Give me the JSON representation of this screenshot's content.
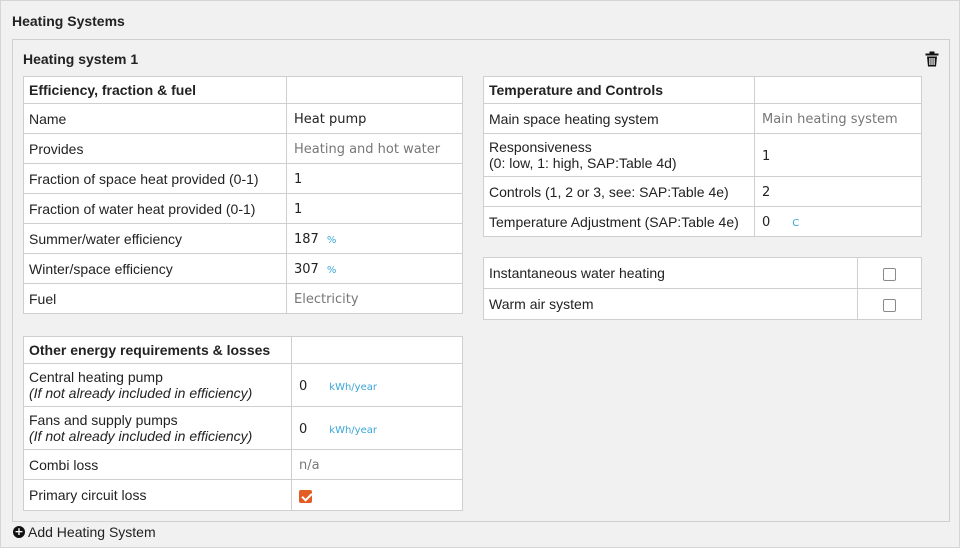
{
  "section_title": "Heating Systems",
  "system": {
    "title": "Heating system 1",
    "delete_icon": "trash-icon"
  },
  "efficiency": {
    "header": "Efficiency, fraction & fuel",
    "rows": [
      {
        "label": "Name",
        "value": "Heat pump"
      },
      {
        "label": "Provides",
        "value": "Heating and hot water"
      },
      {
        "label": "Fraction of space heat provided (0-1)",
        "value": "1"
      },
      {
        "label": "Fraction of water heat provided (0-1)",
        "value": "1"
      },
      {
        "label": "Summer/water efficiency",
        "value": "187",
        "unit": "%"
      },
      {
        "label": "Winter/space efficiency",
        "value": "307",
        "unit": "%"
      },
      {
        "label": "Fuel",
        "value": "Electricity"
      }
    ]
  },
  "temperature": {
    "header": "Temperature and Controls",
    "rows": [
      {
        "label": "Main space heating system",
        "value": "Main heating system"
      },
      {
        "label": "Responsiveness",
        "sublabel": "(0: low, 1: high, SAP:Table 4d)",
        "value": "1"
      },
      {
        "label": "Controls (1, 2 or 3, see: SAP:Table 4e)",
        "value": "2"
      },
      {
        "label": "Temperature Adjustment (SAP:Table 4e)",
        "value": "0",
        "unit": "C"
      }
    ]
  },
  "flags": [
    {
      "label": "Instantaneous water heating",
      "checked": false
    },
    {
      "label": "Warm air system",
      "checked": false
    }
  ],
  "other": {
    "header": "Other energy requirements & losses",
    "rows": [
      {
        "label": "Central heating pump",
        "sublabel": "(If not already included in efficiency)",
        "value": "0",
        "unit": "kWh/year"
      },
      {
        "label": "Fans and supply pumps",
        "sublabel": "(If not already included in efficiency)",
        "value": "0",
        "unit": "kWh/year"
      },
      {
        "label": "Combi loss",
        "value": "n/a"
      },
      {
        "label": "Primary circuit loss",
        "checked": true
      }
    ]
  },
  "add_button": {
    "label": "Add Heating System",
    "icon": "plus-circle-icon"
  },
  "colors": {
    "accent": "#e35c23",
    "unit": "#3aa6d8",
    "panel": "#f1f1f1"
  }
}
